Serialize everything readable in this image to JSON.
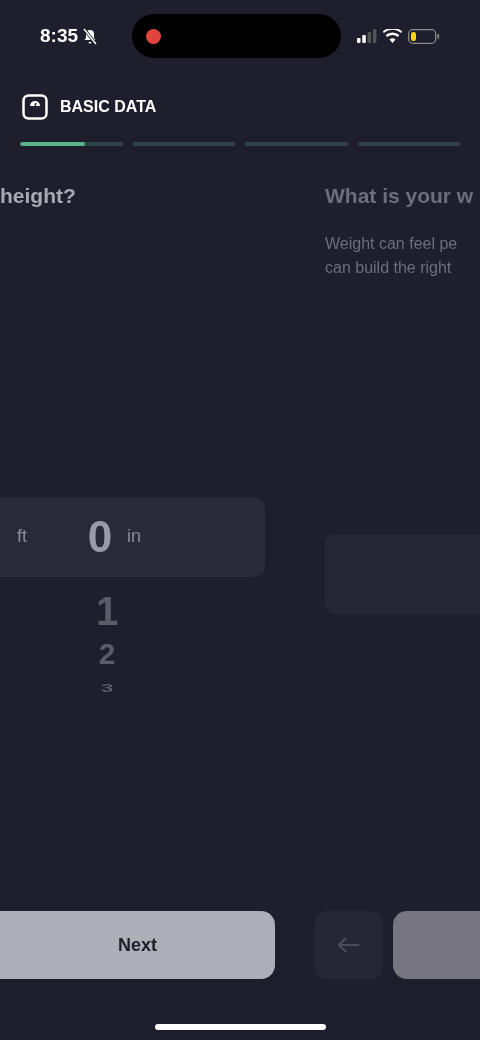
{
  "status_bar": {
    "time": "8:35"
  },
  "header": {
    "title": "BASIC DATA"
  },
  "progress": [
    {
      "level": 0.63
    },
    {
      "level": 0
    },
    {
      "level": 0
    },
    {
      "level": 0
    }
  ],
  "height_page": {
    "title": "height?",
    "units": [
      "ft",
      "in"
    ],
    "values": [
      {
        "text": "0",
        "selected": true
      },
      {
        "text": "1",
        "selected": false
      },
      {
        "text": "2",
        "selected": false
      },
      {
        "text": "3",
        "selected": false
      }
    ],
    "next_button": "Next"
  },
  "weight_page": {
    "title": "What is your w",
    "description": [
      "Weight can feel pe",
      "can build the right"
    ]
  }
}
